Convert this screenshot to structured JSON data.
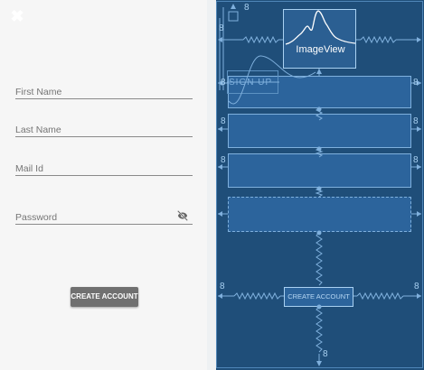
{
  "design": {
    "close_icon": "close-icon",
    "ghost_label": "",
    "fields": [
      {
        "label": "First Name"
      },
      {
        "label": "Last Name"
      },
      {
        "label": "Mail Id"
      },
      {
        "label": "Password",
        "icon": "visibility-off-icon"
      }
    ],
    "create_button": "CREATE ACCOUNT"
  },
  "blueprint": {
    "imageview_label": "ImageView",
    "signup_label": "SIGN UP",
    "create_button": "CREATE ACCOUNT",
    "margin_values": {
      "top_right": "8",
      "left_top": "8",
      "box1_left": "8",
      "box1_right": "8",
      "box2_left": "8",
      "box2_right": "8",
      "box3_left": "8",
      "box3_right": "8",
      "create_left": "8",
      "create_right": "8",
      "bottom": "8"
    }
  },
  "colors": {
    "blueprint_bg": "#1f4e79",
    "blueprint_line": "#7fb0dd",
    "design_bg": "#f6f6f6",
    "button_bg": "#707070"
  }
}
